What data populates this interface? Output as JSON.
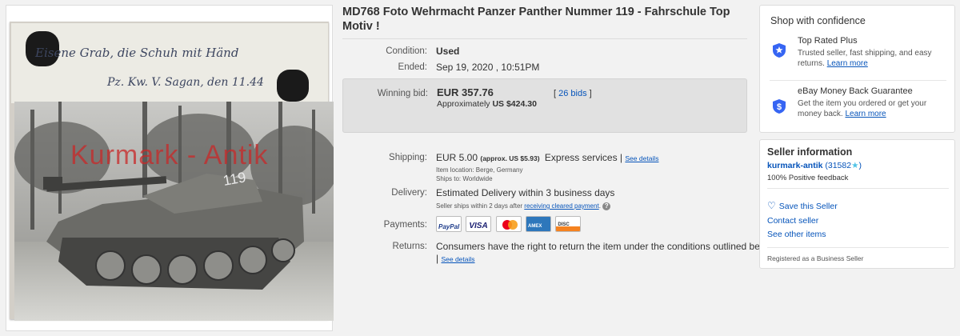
{
  "listing": {
    "title": "MD768 Foto Wehrmacht Panzer Panther Nummer 119 - Fahrschule Top Motiv !",
    "photo": {
      "handwriting_line1": "Eisene Grab, die Schuh mit Händ",
      "handwriting_line2": "Pz. Kw. V.     Sagan, den 11.44",
      "watermark": "Kurmark - Antik",
      "tank_number": "119"
    },
    "condition": {
      "label": "Condition:",
      "value": "Used"
    },
    "ended": {
      "label": "Ended:",
      "value": "Sep 19, 2020 , 10:51PM"
    },
    "winning_bid": {
      "label": "Winning bid:",
      "amount": "EUR 357.76",
      "approx_prefix": "Approximately",
      "approx_value": "US $424.30",
      "bids_open": "[",
      "bids_link": "26 bids",
      "bids_close": "]"
    },
    "shipping": {
      "label": "Shipping:",
      "amount": "EUR 5.00",
      "approx": "(approx. US $5.93)",
      "service": "Express services |",
      "see_details": "See details",
      "item_location": "Item location:  Berge, Germany",
      "ships_to": "Ships to:  Worldwide"
    },
    "delivery": {
      "label": "Delivery:",
      "value": "Estimated Delivery within 3 business days",
      "note_prefix": "Seller ships within 2 days after",
      "note_link": "receiving cleared payment",
      "note_suffix": "."
    },
    "payments": {
      "label": "Payments:",
      "methods": [
        "PayPal",
        "VISA",
        "MasterCard",
        "AMERICAN EXPRESS",
        "DISCOVER"
      ]
    },
    "returns": {
      "label": "Returns:",
      "value": "Consumers have the right to return the item under the conditions outlined below",
      "sep": "|",
      "see_details": "See details"
    }
  },
  "confidence": {
    "heading": "Shop with confidence",
    "top_rated": {
      "icon": "shield-star-icon",
      "title": "Top Rated Plus",
      "text": "Trusted seller, fast shipping, and easy returns.",
      "link": "Learn more"
    },
    "guarantee": {
      "icon": "shield-dollar-icon",
      "title": "eBay Money Back Guarantee",
      "text": "Get the item you ordered or get your money back.",
      "link": "Learn more"
    }
  },
  "seller": {
    "heading": "Seller information",
    "name": "kurmark-antik",
    "score_open": "(31582",
    "score_close": ")",
    "feedback": "100% Positive feedback",
    "save_label": "Save this Seller",
    "contact_label": "Contact seller",
    "other_items_label": "See other items",
    "registered": "Registered as a Business Seller"
  },
  "colors": {
    "link": "#0654ba",
    "bid_box": "#e1e1e1",
    "page_bg": "#f2f2f2"
  }
}
